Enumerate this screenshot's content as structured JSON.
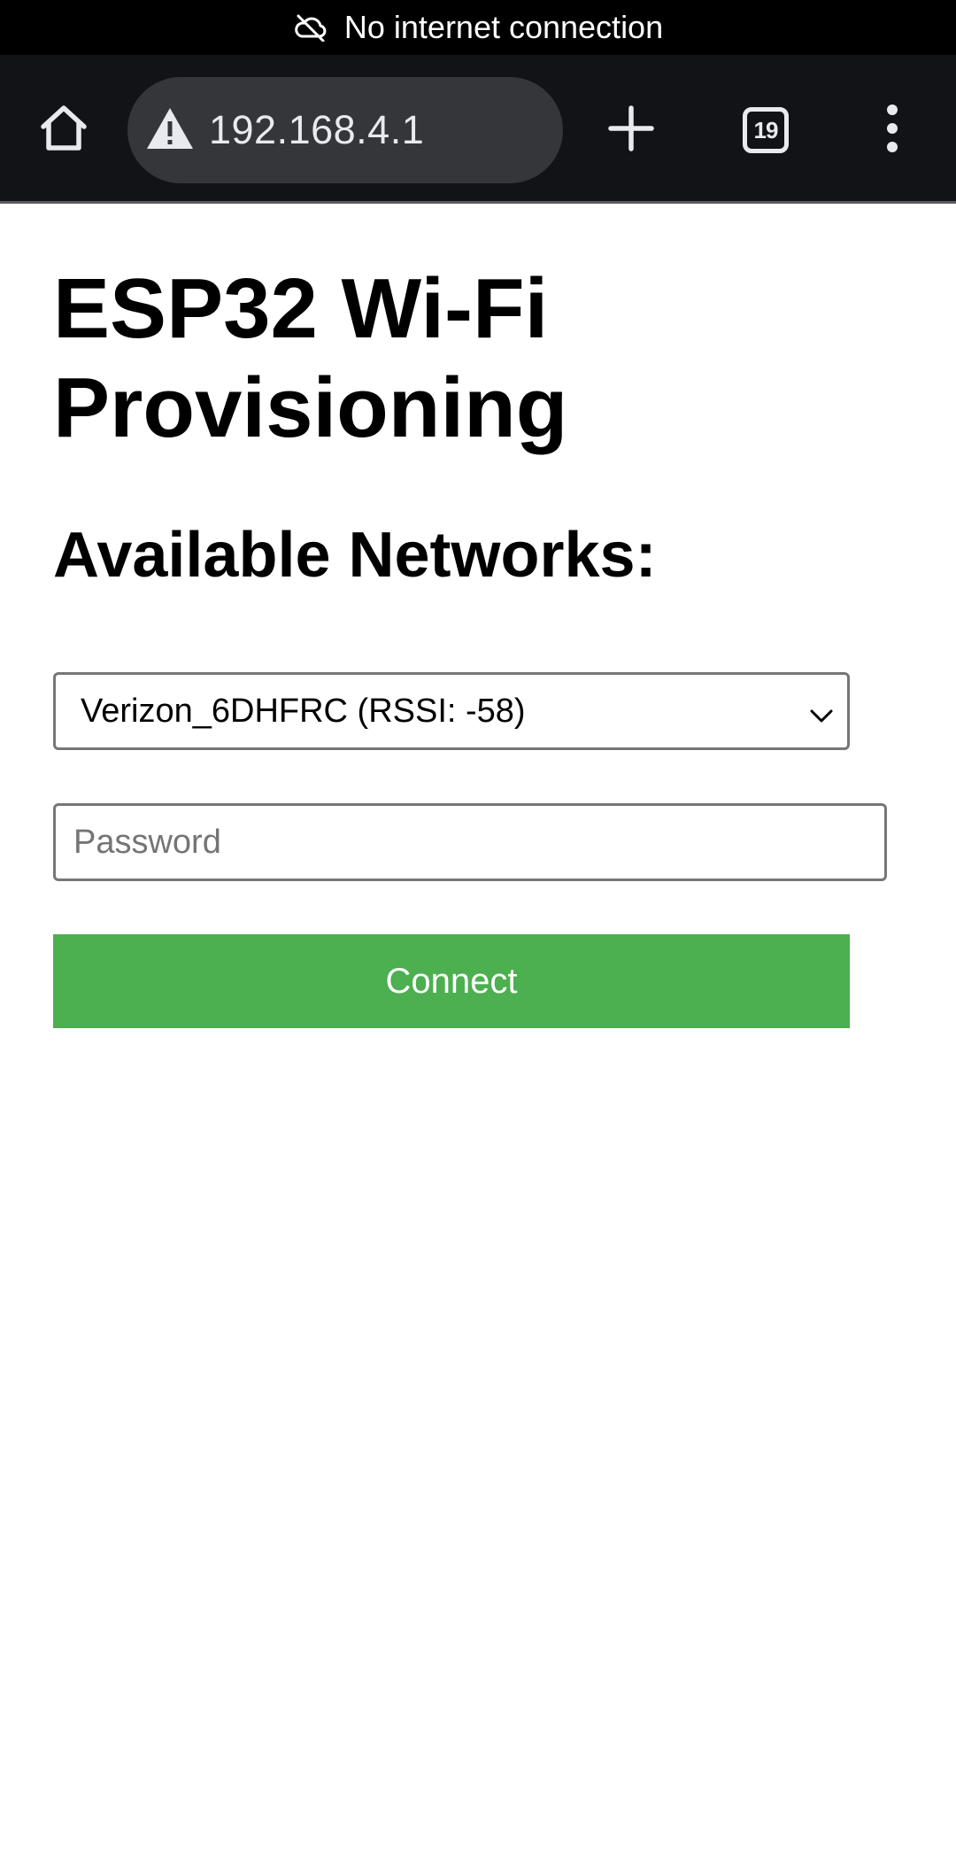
{
  "status_bar": {
    "icon": "cloud-off-icon",
    "text": "No internet connection"
  },
  "browser": {
    "url": "192.168.4.1",
    "security_icon": "warning-icon",
    "tab_count": "19",
    "colors": {
      "toolbar_bg": "#111317",
      "omnibox_bg": "#34363a"
    }
  },
  "page": {
    "title": "ESP32 Wi-Fi Provisioning",
    "subtitle": "Available Networks:",
    "network_select": {
      "selected": "Verizon_6DHFRC (RSSI: -58)"
    },
    "password": {
      "placeholder": "Password",
      "value": ""
    },
    "connect_label": "Connect",
    "colors": {
      "connect_button": "#4caf50"
    }
  }
}
